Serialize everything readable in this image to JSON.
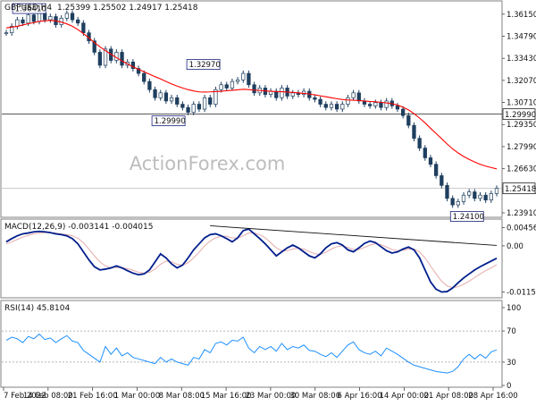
{
  "header": {
    "symbol": "GBPUSD,H4",
    "ohlc": "1.25399 1.25502 1.24917 1.25418"
  },
  "watermark": "ActionForex.com",
  "chart_data": [
    {
      "type": "candlestick",
      "title": "GBPUSD,H4 1.25399 1.25502 1.24917 1.25418",
      "ylim": [
        1.238,
        1.368
      ],
      "yticks": [
        "1.36150",
        "1.34790",
        "1.33430",
        "1.32070",
        "1.30710",
        "1.29350",
        "1.27990",
        "1.26630",
        "1.25270",
        "1.23910"
      ],
      "yticks_values": [
        1.3615,
        1.3479,
        1.3343,
        1.3207,
        1.3071,
        1.2935,
        1.2799,
        1.2663,
        1.2527,
        1.2391
      ],
      "horizontal_lines": [
        1.2999,
        1.25418
      ],
      "tag_current": "1.25418",
      "tag_level": "1.29990",
      "ma_color": "#ff0000",
      "candle_color": "#1f3f5f",
      "annotations": [
        {
          "label": "1.36410",
          "x": 0.02,
          "y": 1.3641
        },
        {
          "label": "1.32970",
          "x": 0.37,
          "y": 1.3297
        },
        {
          "label": "1.29990",
          "x": 0.3,
          "y": 1.2999
        },
        {
          "label": "1.24100",
          "x": 0.9,
          "y": 1.241
        }
      ],
      "close": [
        1.35,
        1.354,
        1.358,
        1.356,
        1.361,
        1.357,
        1.362,
        1.358,
        1.36,
        1.355,
        1.359,
        1.362,
        1.358,
        1.356,
        1.35,
        1.345,
        1.338,
        1.33,
        1.34,
        1.333,
        1.338,
        1.33,
        1.332,
        1.328,
        1.325,
        1.32,
        1.315,
        1.31,
        1.313,
        1.308,
        1.31,
        1.306,
        1.304,
        1.301,
        1.306,
        1.303,
        1.31,
        1.306,
        1.315,
        1.318,
        1.316,
        1.32,
        1.321,
        1.325,
        1.318,
        1.313,
        1.316,
        1.312,
        1.314,
        1.31,
        1.316,
        1.311,
        1.313,
        1.312,
        1.314,
        1.31,
        1.309,
        1.306,
        1.304,
        1.306,
        1.303,
        1.306,
        1.31,
        1.313,
        1.308,
        1.306,
        1.305,
        1.307,
        1.304,
        1.308,
        1.305,
        1.303,
        1.299,
        1.293,
        1.285,
        1.279,
        1.273,
        1.269,
        1.262,
        1.256,
        1.248,
        1.244,
        1.246,
        1.25,
        1.252,
        1.248,
        1.25,
        1.247,
        1.251,
        1.2542
      ],
      "ma": [
        1.353,
        1.3535,
        1.354,
        1.3548,
        1.3556,
        1.3563,
        1.357,
        1.3574,
        1.3577,
        1.3573,
        1.3566,
        1.3555,
        1.354,
        1.352,
        1.3495,
        1.3468,
        1.344,
        1.3414,
        1.339,
        1.3368,
        1.3347,
        1.3327,
        1.3308,
        1.3291,
        1.3275,
        1.326,
        1.3245,
        1.323,
        1.3216,
        1.32,
        1.3185,
        1.3172,
        1.316,
        1.315,
        1.3142,
        1.3136,
        1.3135,
        1.3136,
        1.3138,
        1.314,
        1.3143,
        1.3146,
        1.3149,
        1.3152,
        1.315,
        1.3147,
        1.3145,
        1.3142,
        1.314,
        1.3138,
        1.3137,
        1.3135,
        1.3133,
        1.313,
        1.3127,
        1.3123,
        1.3118,
        1.3112,
        1.3106,
        1.31,
        1.3094,
        1.3089,
        1.3086,
        1.3085,
        1.3083,
        1.308,
        1.3077,
        1.3075,
        1.3072,
        1.3068,
        1.3063,
        1.3055,
        1.3042,
        1.3025,
        1.3002,
        1.2975,
        1.2945,
        1.2912,
        1.288,
        1.2848,
        1.2815,
        1.2785,
        1.276,
        1.2738,
        1.272,
        1.2704,
        1.269,
        1.2679,
        1.267,
        1.2662
      ]
    },
    {
      "type": "line",
      "title": "MACD(12,26,9) -0.003141 -0.004015",
      "ylim": [
        -0.0125,
        0.006
      ],
      "yticks": [
        "0.00456",
        "0.00",
        "-0.011529"
      ],
      "yticks_values": [
        0.00456,
        0.0,
        -0.011529
      ],
      "main_color": "#001e8c",
      "signal_color": "#e6aaaa",
      "macd": [
        0.001,
        0.0018,
        0.0025,
        0.003,
        0.0032,
        0.0035,
        0.0036,
        0.0035,
        0.0033,
        0.003,
        0.0028,
        0.0025,
        0.0018,
        0.0005,
        -0.0015,
        -0.0035,
        -0.0052,
        -0.006,
        -0.0058,
        -0.0055,
        -0.005,
        -0.0055,
        -0.0062,
        -0.0068,
        -0.0072,
        -0.007,
        -0.006,
        -0.004,
        -0.002,
        -0.003,
        -0.0045,
        -0.0055,
        -0.0048,
        -0.003,
        -0.001,
        0.0005,
        0.002,
        0.0028,
        0.003,
        0.0025,
        0.0018,
        0.001,
        0.002,
        0.0038,
        0.0042,
        0.003,
        0.0018,
        0.0005,
        -0.001,
        -0.0025,
        -0.0015,
        -0.0005,
        0.0002,
        -0.0005,
        -0.0015,
        -0.0025,
        -0.003,
        -0.002,
        -0.0005,
        0.0005,
        0.0008,
        0.0002,
        -0.001,
        -0.0015,
        -0.0005,
        0.0006,
        0.0012,
        0.0008,
        -0.0002,
        -0.0012,
        -0.0018,
        -0.0015,
        -0.0008,
        -0.0003,
        -0.001,
        -0.003,
        -0.006,
        -0.009,
        -0.0108,
        -0.0115,
        -0.0114,
        -0.0105,
        -0.0092,
        -0.008,
        -0.007,
        -0.006,
        -0.0052,
        -0.0045,
        -0.0038,
        -0.0031
      ],
      "signal": [
        0.0005,
        0.001,
        0.0016,
        0.0022,
        0.0026,
        0.003,
        0.0032,
        0.0033,
        0.0033,
        0.0032,
        0.003,
        0.0028,
        0.0025,
        0.0019,
        0.0008,
        -0.0008,
        -0.0025,
        -0.004,
        -0.005,
        -0.0054,
        -0.0054,
        -0.0054,
        -0.0057,
        -0.0061,
        -0.0066,
        -0.0068,
        -0.0066,
        -0.0058,
        -0.0046,
        -0.0038,
        -0.004,
        -0.0046,
        -0.0048,
        -0.0042,
        -0.003,
        -0.0016,
        0.0,
        0.0012,
        0.002,
        0.0024,
        0.0024,
        0.002,
        0.002,
        0.0025,
        0.0032,
        0.0032,
        0.0028,
        0.002,
        0.0008,
        -0.0005,
        -0.0012,
        -0.0012,
        -0.0008,
        -0.0006,
        -0.0008,
        -0.0014,
        -0.002,
        -0.0021,
        -0.0016,
        -0.0008,
        -0.0002,
        0.0,
        -0.0004,
        -0.0009,
        -0.0009,
        -0.0004,
        0.0002,
        0.0005,
        0.0003,
        -0.0003,
        -0.0009,
        -0.0012,
        -0.0011,
        -0.0008,
        -0.0008,
        -0.0015,
        -0.003,
        -0.005,
        -0.007,
        -0.0088,
        -0.01,
        -0.0104,
        -0.0102,
        -0.0096,
        -0.0088,
        -0.0079,
        -0.007,
        -0.0062,
        -0.0055,
        -0.0047
      ]
    },
    {
      "type": "line",
      "title": "RSI(14) 45.8104",
      "ylim": [
        0,
        100
      ],
      "yticks": [
        "100",
        "70",
        "30",
        "0"
      ],
      "yticks_values": [
        100,
        70,
        30,
        0
      ],
      "levels": [
        70,
        30
      ],
      "line_color": "#1e90ff",
      "rsi": [
        58,
        62,
        60,
        55,
        63,
        60,
        66,
        59,
        61,
        55,
        60,
        64,
        57,
        55,
        45,
        40,
        35,
        30,
        50,
        40,
        48,
        38,
        42,
        36,
        34,
        32,
        30,
        28,
        36,
        30,
        34,
        30,
        28,
        26,
        36,
        34,
        46,
        42,
        54,
        56,
        52,
        58,
        57,
        62,
        48,
        42,
        50,
        46,
        50,
        44,
        54,
        46,
        50,
        48,
        52,
        45,
        44,
        40,
        37,
        42,
        36,
        44,
        52,
        56,
        46,
        42,
        40,
        44,
        38,
        48,
        44,
        40,
        35,
        30,
        26,
        24,
        22,
        20,
        18,
        17,
        16,
        18,
        24,
        34,
        40,
        34,
        40,
        35,
        43,
        45.8
      ]
    }
  ],
  "x_axis": {
    "labels": [
      "7 Feb 2022",
      "14 Feb 08:00",
      "21 Feb 16:00",
      "1 Mar 00:00",
      "8 Mar 08:00",
      "15 Mar 16:00",
      "23 Mar 00:00",
      "30 Mar 08:00",
      "6 Apr 16:00",
      "14 Apr 00:00",
      "21 Apr 08:00",
      "28 Apr 16:00"
    ]
  }
}
